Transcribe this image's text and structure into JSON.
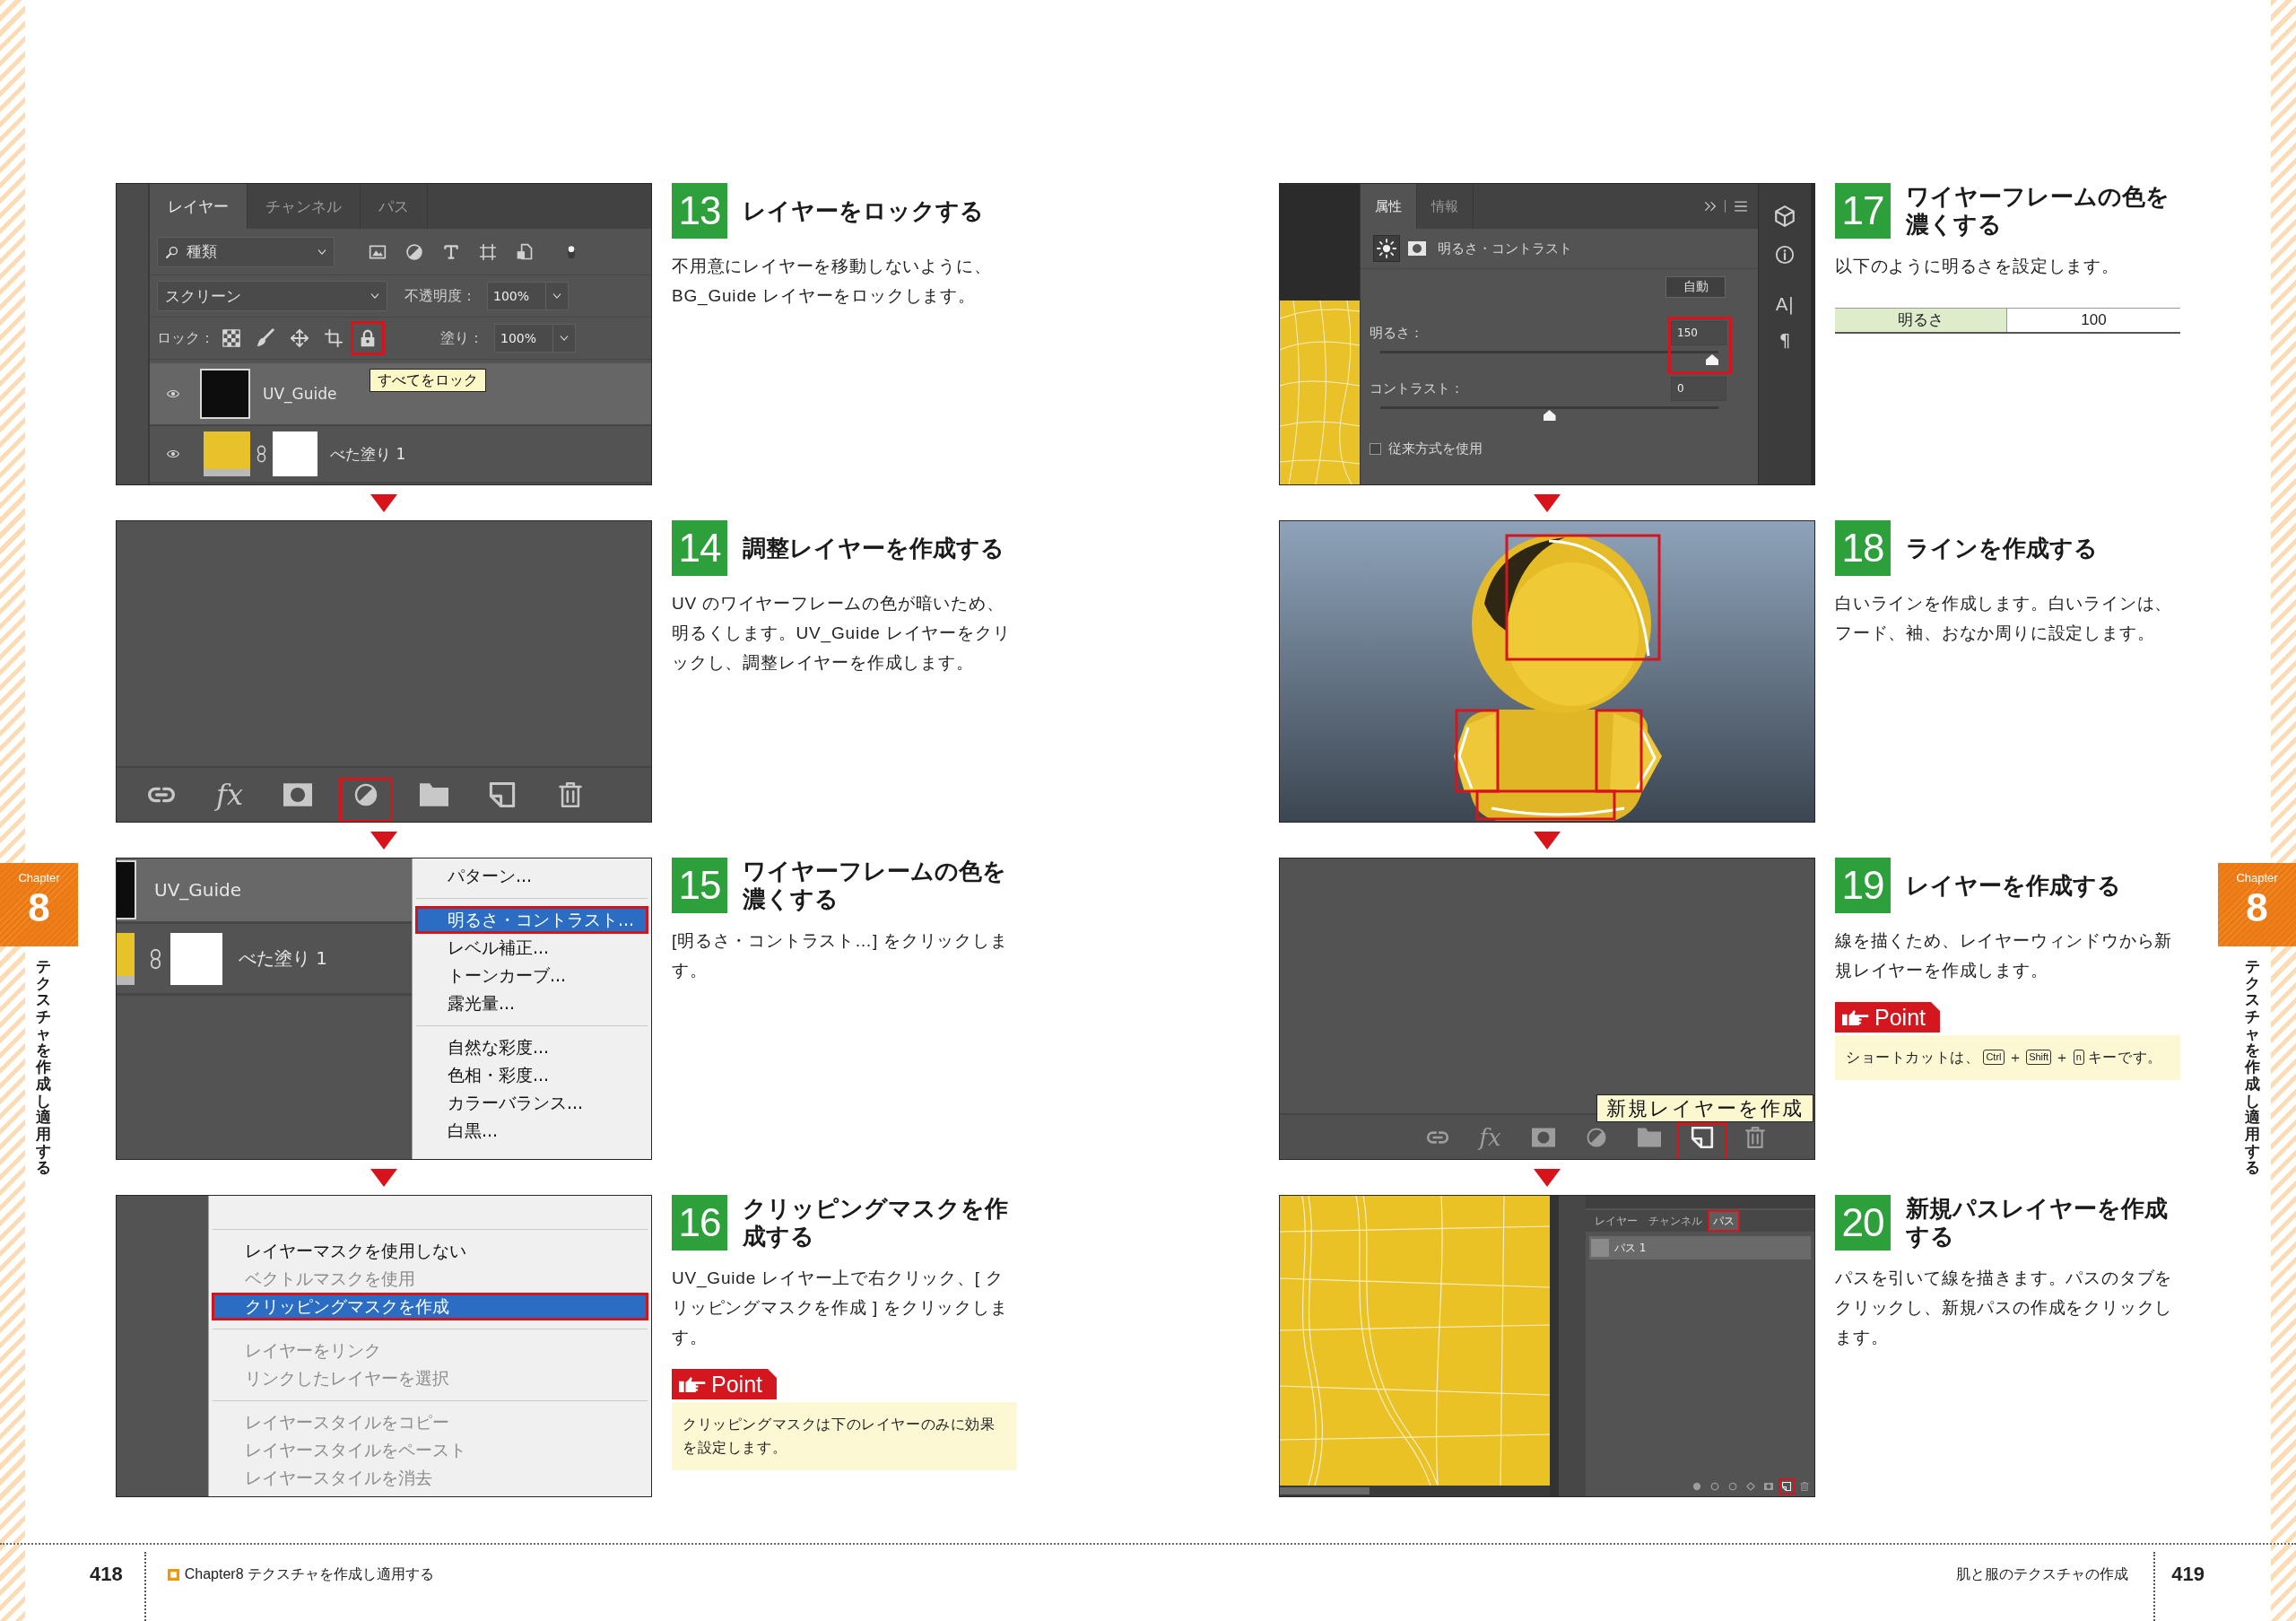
{
  "pages": [
    {
      "tab": {
        "label": "Chapter",
        "number": "8",
        "title": "テクスチャを作成し適用する"
      },
      "steps": [
        {
          "number": "13",
          "title": "レイヤーをロックする",
          "body": "不用意にレイヤーを移動しないように、BG_Guide レイヤーをロックします。",
          "screenshot": {
            "kind": "layers_panel",
            "tabs": [
              {
                "label": "レイヤー",
                "selected": true
              },
              {
                "label": "チャンネル",
                "selected": false
              },
              {
                "label": "パス",
                "selected": false
              }
            ],
            "filter": "種類",
            "blend_mode": "スクリーン",
            "opacity_label": "不透明度：",
            "opacity": "100%",
            "lock_label": "ロック：",
            "lock_icons": [
              {
                "highlighted": false
              },
              {
                "highlighted": false
              },
              {
                "highlighted": false
              },
              {
                "highlighted": false
              },
              {
                "highlighted": true
              }
            ],
            "fill_label": "塗り：",
            "fill": "100%",
            "tooltip": "すべてをロック",
            "layers": [
              {
                "kind": "image",
                "name": "UV_Guide",
                "selected": true
              },
              {
                "kind": "fill",
                "name": "べた塗り 1",
                "selected": false
              }
            ]
          }
        },
        {
          "number": "14",
          "title": "調整レイヤーを作成する",
          "body": "UV のワイヤーフレームの色が暗いため、明るくします。UV_Guide レイヤーをクリックし、調整レイヤーを作成します。",
          "screenshot": {
            "kind": "toolbar_closeup",
            "tools": [
              {
                "highlighted": false
              },
              {
                "text": "fx",
                "highlighted": false
              },
              {
                "highlighted": false
              },
              {
                "highlighted": true
              },
              {
                "highlighted": false
              },
              {
                "highlighted": false
              },
              {
                "highlighted": false
              }
            ]
          }
        },
        {
          "number": "15",
          "title": "ワイヤーフレームの色を濃くする",
          "body": "[明るさ・コントラスト…] をクリックします。",
          "screenshot": {
            "kind": "adjust_menu",
            "layers": [
              {
                "kind": "image",
                "name": "UV_Guide",
                "selected": true
              },
              {
                "kind": "fill",
                "name": "べた塗り 1",
                "selected": false
              }
            ],
            "menu": {
              "scrolled": false,
              "groups": [
                [
                  {
                    "label": "パターン...",
                    "selected": false
                  }
                ],
                [
                  {
                    "label": "明るさ・コントラスト...",
                    "selected": true
                  },
                  {
                    "label": "レベル補正...",
                    "selected": false
                  },
                  {
                    "label": "トーンカーブ...",
                    "selected": false
                  },
                  {
                    "label": "露光量...",
                    "selected": false
                  }
                ],
                [
                  {
                    "label": "自然な彩度...",
                    "selected": false
                  },
                  {
                    "label": "色相・彩度...",
                    "selected": false
                  },
                  {
                    "label": "カラーバランス...",
                    "selected": false
                  },
                  {
                    "label": "白黒...",
                    "selected": false
                  }
                ]
              ]
            }
          }
        },
        {
          "number": "16",
          "title": "クリッピングマスクを作成する",
          "body": "UV_Guide レイヤー上で右クリック、[ クリッピングマスクを作成 ] をクリックします。",
          "screenshot": {
            "kind": "context_menu",
            "menu": {
              "scrolled": true,
              "groups": [
                [
                  {
                    "label": "レイヤーマスクを使用しない",
                    "selected": false,
                    "disabled": false
                  },
                  {
                    "label": "ベクトルマスクを使用",
                    "selected": false,
                    "disabled": true
                  },
                  {
                    "label": "クリッピングマスクを作成",
                    "selected": true,
                    "disabled": false
                  }
                ],
                [
                  {
                    "label": "レイヤーをリンク",
                    "selected": false,
                    "disabled": true
                  },
                  {
                    "label": "リンクしたレイヤーを選択",
                    "selected": false,
                    "disabled": true
                  }
                ],
                [
                  {
                    "label": "レイヤースタイルをコピー",
                    "selected": false,
                    "disabled": true
                  },
                  {
                    "label": "レイヤースタイルをペースト",
                    "selected": false,
                    "disabled": true
                  },
                  {
                    "label": "レイヤースタイルを消去",
                    "selected": false,
                    "disabled": true
                  }
                ]
              ]
            }
          },
          "point": {
            "label": "Point",
            "parts": [
              {
                "kind": "text",
                "text": "クリッピングマスクは下のレイヤーのみに効果を設定します。"
              }
            ]
          }
        }
      ],
      "footer": {
        "page_number": "418",
        "running_title": "Chapter8 テクスチャを作成し適用する"
      }
    },
    {
      "tab": {
        "label": "Chapter",
        "number": "8",
        "title": "テクスチャを作成し適用する"
      },
      "steps": [
        {
          "number": "17",
          "title": "ワイヤーフレームの色を濃くする",
          "body": "以下のように明るさを設定します。",
          "screenshot": {
            "kind": "properties_panel",
            "tabs": [
              {
                "label": "属性",
                "selected": true
              },
              {
                "label": "情報",
                "selected": false
              }
            ],
            "title": "明るさ・コントラスト",
            "auto_button": "自動",
            "sliders": [
              {
                "label": "明るさ：",
                "value": "150",
                "level": 1,
                "highlighted": true
              },
              {
                "label": "コントラスト：",
                "value": "0",
                "level": 0.5,
                "highlighted": false
              }
            ],
            "checkbox": {
              "label": "従来方式を使用",
              "checked": false
            },
            "dock_buttons": [
              "A|",
              "¶"
            ]
          },
          "table": [
            {
              "label": "明るさ",
              "value": "100"
            }
          ]
        },
        {
          "number": "18",
          "title": "ラインを作成する",
          "body": "白いラインを作成します。白いラインは、フード、袖、おなか周りに設定します。",
          "screenshot": {
            "kind": "render"
          }
        },
        {
          "number": "19",
          "title": "レイヤーを作成する",
          "body": "線を描くため、レイヤーウィンドウから新規レイヤーを作成します。",
          "screenshot": {
            "kind": "toolbar_with_tooltip",
            "tooltip": "新規レイヤーを作成",
            "tools": [
              {
                "highlighted": false
              },
              {
                "text": "fx",
                "highlighted": false
              },
              {
                "highlighted": false
              },
              {
                "highlighted": false
              },
              {
                "highlighted": false
              },
              {
                "highlighted": true
              },
              {
                "highlighted": false
              }
            ]
          },
          "point": {
            "label": "Point",
            "parts": [
              {
                "kind": "text",
                "text": "ショートカットは、"
              },
              {
                "kind": "key",
                "text": "Ctrl"
              },
              {
                "kind": "text",
                "text": "＋"
              },
              {
                "kind": "key",
                "text": "Shift"
              },
              {
                "kind": "text",
                "text": "＋"
              },
              {
                "kind": "key",
                "text": "n"
              },
              {
                "kind": "text",
                "text": "キーです。"
              }
            ]
          }
        },
        {
          "number": "20",
          "title": "新規パスレイヤーを作成する",
          "body": "パスを引いて線を描きます。パスのタブをクリックし、新規パスの作成をクリックします。",
          "screenshot": {
            "kind": "paths_panel",
            "tabs": [
              {
                "label": "レイヤー",
                "selected": false,
                "highlighted": false
              },
              {
                "label": "チャンネル",
                "selected": false,
                "highlighted": false
              },
              {
                "label": "パス",
                "selected": true,
                "highlighted": true
              }
            ],
            "paths": [
              {
                "name": "パス 1",
                "selected": true
              }
            ],
            "tools": [
              {
                "highlighted": false
              },
              {
                "highlighted": false
              },
              {
                "highlighted": false
              },
              {
                "highlighted": false
              },
              {
                "highlighted": false
              },
              {
                "highlighted": true
              },
              {
                "highlighted": false
              }
            ]
          }
        }
      ],
      "footer": {
        "page_number": "419",
        "running_title": "肌と服のテクスチャの作成"
      }
    }
  ]
}
